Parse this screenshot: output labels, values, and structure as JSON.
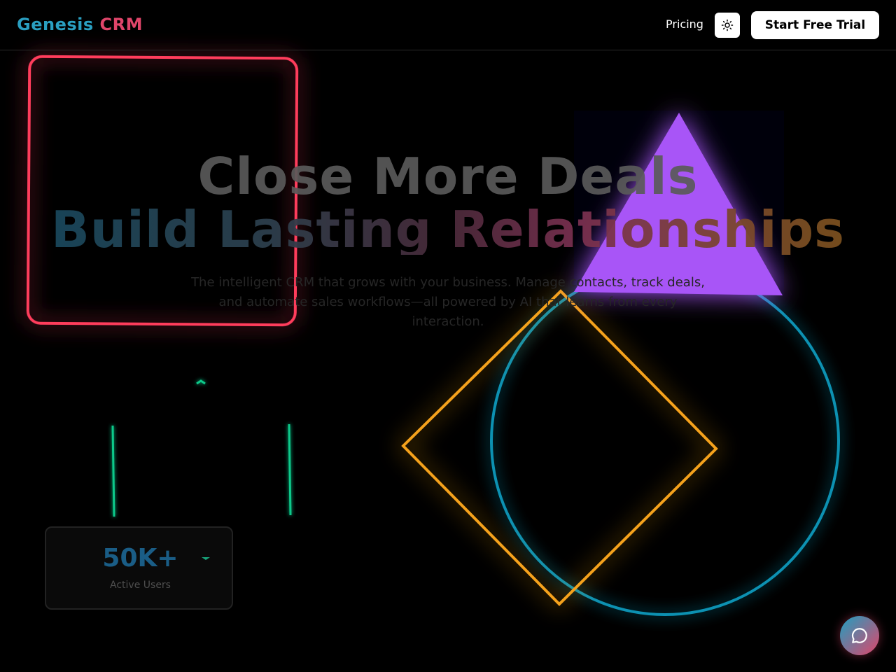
{
  "header": {
    "logo_part1": "Genesis",
    "logo_part2": "CRM",
    "nav_pricing": "Pricing",
    "theme_toggle_icon": "sun-icon",
    "cta_label": "Start Free Trial"
  },
  "hero": {
    "title_line1": "Close More Deals",
    "title_line2": "Build Lasting Relationships",
    "subtitle": "The intelligent CRM that grows with your business. Manage contacts, track deals, and automate sales workflows—all powered by AI that learns from every interaction."
  },
  "stat": {
    "value": "50K+",
    "label": "Active Users"
  },
  "chat": {
    "icon": "chat-bubble-icon"
  },
  "colors": {
    "brand_blue": "#2a9fc1",
    "brand_pink": "#e0456a",
    "shape_red": "#ff3c5c",
    "shape_purple": "#a855f7",
    "shape_orange": "#f5a21b",
    "shape_cyan": "#0891b2",
    "shape_green": "#10c98a"
  }
}
